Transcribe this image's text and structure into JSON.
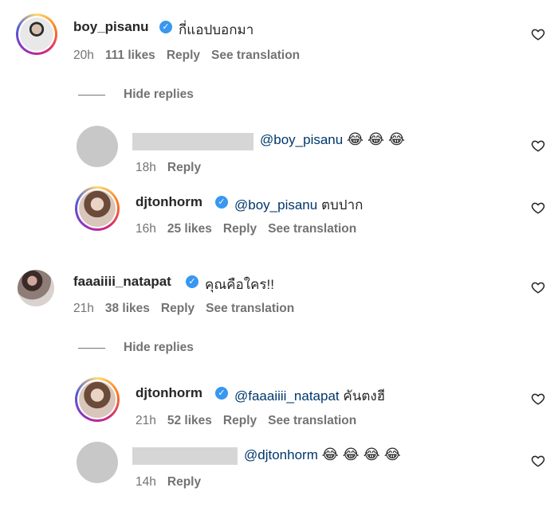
{
  "comments": [
    {
      "username": "boy_pisanu",
      "text": "กี่แอปบอกมา",
      "time": "20h",
      "likes": "111 likes",
      "reply": "Reply",
      "translate": "See translation"
    },
    {
      "mention": "@boy_pisanu",
      "emojis": "😂 😂 😂",
      "time": "18h",
      "reply": "Reply"
    },
    {
      "username": "djtonhorm",
      "mention": "@boy_pisanu",
      "text": "ตบปาก",
      "time": "16h",
      "likes": "25 likes",
      "reply": "Reply",
      "translate": "See translation"
    },
    {
      "username": "faaaiiii_natapat",
      "text": "คุณคือใคร!!",
      "time": "21h",
      "likes": "38 likes",
      "reply": "Reply",
      "translate": "See translation"
    },
    {
      "username": "djtonhorm",
      "mention": "@faaaiiii_natapat",
      "text": "คันตงฮี",
      "time": "21h",
      "likes": "52 likes",
      "reply": "Reply",
      "translate": "See translation"
    },
    {
      "mention": "@djtonhorm",
      "emojis": "😂 😂 😂 😂",
      "time": "14h",
      "reply": "Reply"
    }
  ],
  "hide_replies_label": "Hide replies",
  "icons": {
    "verified": "verified-badge-icon",
    "like": "heart-icon"
  },
  "colors": {
    "mention": "#00376b",
    "verified": "#3897f0",
    "meta": "#737373"
  }
}
